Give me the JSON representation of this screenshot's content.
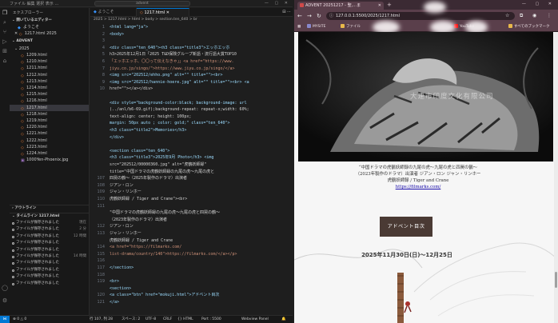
{
  "vscode": {
    "titlebar": {
      "menu": "ファイル 編集 選択 表示 …",
      "command_center": "advent",
      "window_controls": "— ▢ ✕"
    },
    "sidebar": {
      "header": "エクスプローラー",
      "open_editors_label": "開いているエディター",
      "open_editors": [
        "ようこそ",
        "1217.html 2025"
      ],
      "workspace_label": "ADVENT",
      "folder": "2025",
      "files": [
        "1209.html",
        "1210.html",
        "1211.html",
        "1212.html",
        "1213.html",
        "1214.html",
        "1215.html",
        "1216.html",
        "1217.html",
        "1218.html",
        "1219.html",
        "1220.html",
        "1221.html",
        "1222.html",
        "1223.html",
        "1224.html",
        "1000Yen-Phoenix.jpg"
      ],
      "selected_file": "1217.html",
      "outline_label": "アウトライン",
      "timeline_label": "タイムライン 1217.html",
      "timeline": [
        {
          "text": "ファイルが保存されました",
          "time": "現在"
        },
        {
          "text": "ファイルが保存されました",
          "time": "2 分"
        },
        {
          "text": "ファイルが保存されました",
          "time": "12 時間"
        },
        {
          "text": "ファイルが保存されました",
          "time": ""
        },
        {
          "text": "ファイルが保存されました",
          "time": ""
        },
        {
          "text": "ファイルが保存されました",
          "time": "14 時間"
        },
        {
          "text": "ファイルが保存されました",
          "time": ""
        },
        {
          "text": "ファイルが保存されました",
          "time": ""
        },
        {
          "text": "ファイルが保存されました",
          "time": ""
        },
        {
          "text": "ファイルが保存されました",
          "time": ""
        }
      ]
    },
    "editor": {
      "tabs": [
        "ようこそ",
        "1217.html ✕"
      ],
      "breadcrumb": "2025 > 1217.html > html > body > section.ten_640 > br",
      "line_numbers": [
        "1",
        "2",
        "3",
        "4",
        "5",
        "6",
        "7",
        "8",
        "9",
        "10",
        "",
        "",
        "",
        "",
        "",
        "",
        "",
        "",
        "",
        "",
        "",
        "",
        "107",
        "108",
        "109",
        "110",
        "111",
        "",
        "",
        "112",
        "113",
        "",
        "114",
        "115",
        "116",
        "117",
        "118",
        "119",
        "",
        "120",
        "121"
      ],
      "code": [
        "<html lang=\"ja\">",
        "<body>",
        "",
        "<div class=\"ten_640\"><h3 class=\"title3\">エッホエッホ",
        "h3>2025年12月1日「2025 T&D保険グループ新語・流行語大賞TOP10",
        "「エッホエッホ、〇〇って伝えなきゃ」」<a href=\"https://www.",
        "jiyu.co.jp/singo/\">https://www.jiyu.co.jp/singo/</a>",
        "<img src=\"202512/ehho.png\" alt=\"\" title=\"\"><br>",
        "<img src=\"202512/hannie-hoere.jpg\" alt=\"\" title=\"\"><br> <a",
        "href=\"\"></a></div>",
        "",
        "<div style=\"background-color:black; background-image: url",
        "(../anl/b6-69.gif);background-repeat: repeat-x;width: 60%;",
        " text-align: center;  height: 100px;",
        " margin: 50px auto ;  color: gold;\" class=\"ten_640\">",
        "   <h3 class=\"title2\">Memories</h3>",
        "</div>",
        "",
        "   <section class=\"ten_640\">",
        "         <h3 class=\"title3\">2025年9月 Photo</h3> <img",
        "         src=\"202512/00000360.jpg\" alt=\"虎鶴妖師録\"",
        "         title=\"中国ドラマの虎鶴妖師録の九尾の虎〜九尾の虎と",
        "         四罠の鶴〜（2025年製作のドラマ）出演者",
        "ジアン・ロン",
        "ジャン・リンホー",
        "虎鶴妖師録 / Tiger and Crane\"><br>",
        "",
        "\"中国ドラマの虎鶴妖師録の九尾の虎〜九尾の虎と四罠の鶴〜",
        "（2023年製作のドラマ）出演者",
        "ジアン・ロン",
        "ジャン・リンホー",
        "虎鶴妖師録 / Tiger and Crane",
        "<a href=\"https://filmarks.com/",
        "list-drama/country/140\">https://filmarks.com/</a></p>",
        "",
        "   </section>",
        "",
        "   <br>",
        "   <section>",
        "         <a class=\"btn\" href=\"mokuji.html\">アドベント目次",
        "</a>"
      ]
    },
    "statusbar": {
      "errors": "⊗ 0 △ 0",
      "position": "行 107, 列 28",
      "spaces": "スペース: 2",
      "encoding": "UTF-8",
      "eol": "CRLF",
      "language": "{} HTML",
      "port": "Port : 5500",
      "preview": "Webview Panel"
    }
  },
  "chrome": {
    "tab_title": "ADVENT 20251217 - 聖,…ま",
    "url": "127.0.0.1:5500/2025/1217.html",
    "bookmarks": [
      "MYSITE",
      "ファイル",
      "YouTube",
      "すべてのブックマーク"
    ],
    "page": {
      "hero_watermark": "大連市印度文化有限公司",
      "caption_lines": [
        "“中国ドラマの虎鶴妖師録の九尾の虎〜九尾の虎と四罠の鶴〜",
        "（2023年製作のドラマ）出演者 ジアン・ロン ジャン・リンホー",
        "虎鶴妖師録 / Tiger and Crane"
      ],
      "caption_link": "https://filmarks.com/",
      "advent_button": "アドベント目次",
      "date_range": "2025年11月30日(日)〜12月25日"
    }
  },
  "colors": {
    "vscode_bg": "#1e1e1e",
    "accent": "#0078d4",
    "chrome_toolbar": "#5a3f4b",
    "button_bg": "#4a3a34"
  }
}
